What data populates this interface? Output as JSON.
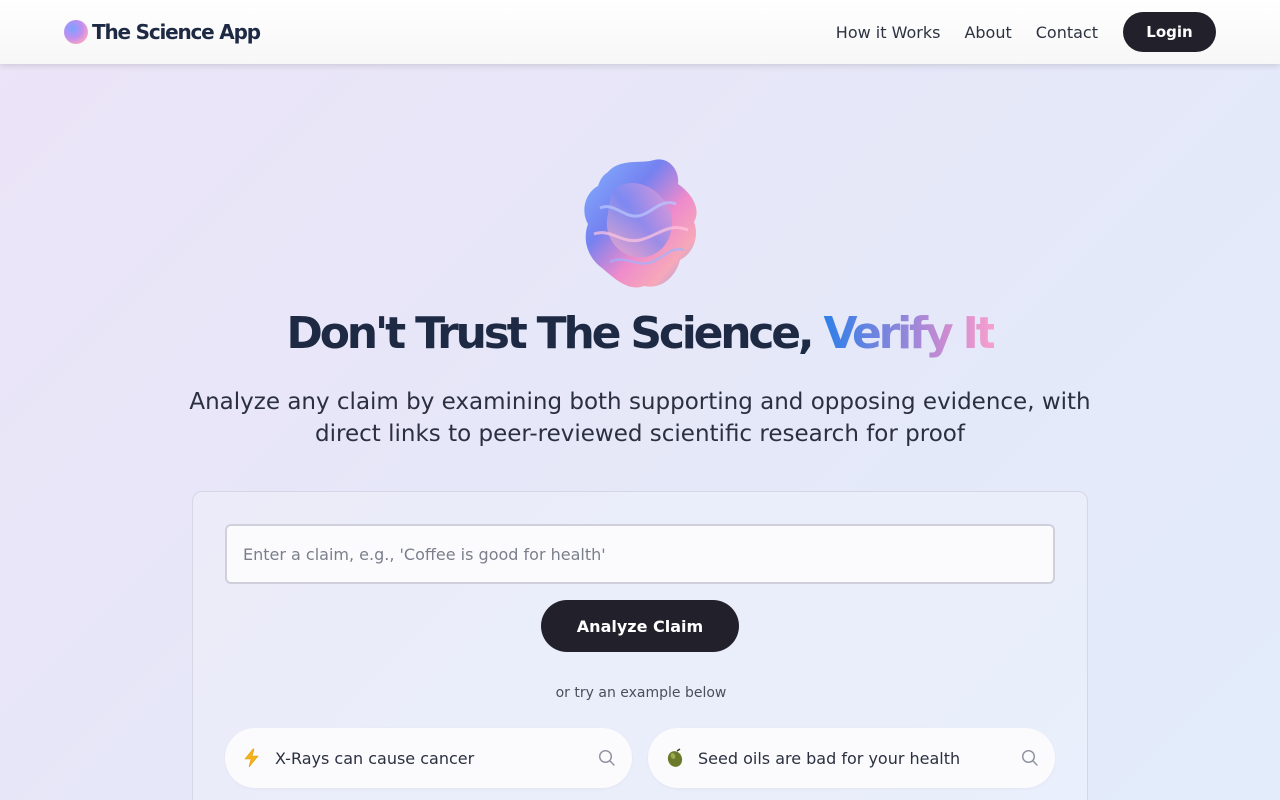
{
  "nav": {
    "brand": "The Science App",
    "links": [
      "How it Works",
      "About",
      "Contact"
    ],
    "login_label": "Login"
  },
  "hero": {
    "headline_main": "Don't Trust The Science, ",
    "headline_accent": "Verify It",
    "subtitle": "Analyze any claim by examining both supporting and opposing evidence, with direct links to peer-reviewed scientific research for proof"
  },
  "form": {
    "claim_placeholder": "Enter a claim, e.g., 'Coffee is good for health'",
    "claim_value": "",
    "analyze_label": "Analyze Claim",
    "example_hint": "or try an example below"
  },
  "examples": [
    {
      "label": "X-Rays can cause cancer",
      "icon": "lightning-icon"
    },
    {
      "label": "Seed oils are bad for your health",
      "icon": "olive-icon"
    }
  ],
  "colors": {
    "headline": "#1e2a44",
    "button_bg": "#22212b",
    "accent_start": "#2f7fe8",
    "accent_end": "#f6a0cf"
  }
}
